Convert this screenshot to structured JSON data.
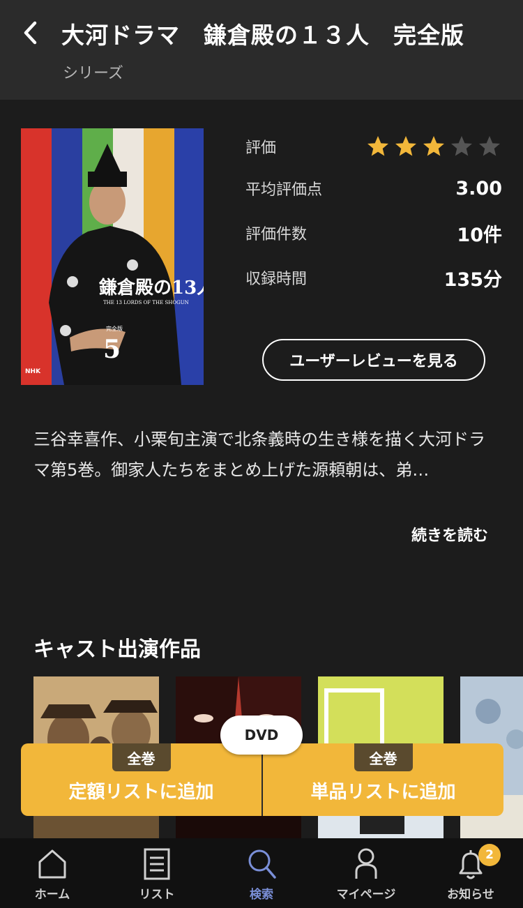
{
  "header": {
    "title": "大河ドラマ　鎌倉殿の１３人　完全版",
    "subtitle": "シリーズ"
  },
  "cover": {
    "title": "鎌倉殿の13人",
    "subtitle": "THE 13 LORDS OF THE SHOGUN",
    "volume_label": "完全版",
    "volume": "5",
    "publisher": "NHK"
  },
  "info": {
    "rating_label": "評価",
    "rating_stars": 3,
    "rating_max": 5,
    "avg_label": "平均評価点",
    "avg_value": "3.00",
    "count_label": "評価件数",
    "count_value": "10件",
    "duration_label": "収録時間",
    "duration_value": "135分"
  },
  "review_button": "ユーザーレビューを見る",
  "description": "三谷幸喜作、小栗旬主演で北条義時の生き様を描く大河ドラマ第5巻。御家人たちをまとめ上げた源頼朝は、弟…",
  "read_more": "続きを読む",
  "cast_section": {
    "title": "キャスト出演作品"
  },
  "add_bar": {
    "format": "DVD",
    "left_badge": "全巻",
    "left_label": "定額リストに追加",
    "right_badge": "全巻",
    "right_label": "単品リストに追加"
  },
  "tabs": [
    {
      "label": "ホーム",
      "icon": "home-icon"
    },
    {
      "label": "リスト",
      "icon": "list-icon"
    },
    {
      "label": "検索",
      "icon": "search-icon"
    },
    {
      "label": "マイページ",
      "icon": "person-icon"
    },
    {
      "label": "お知らせ",
      "icon": "bell-icon",
      "badge": "2"
    }
  ],
  "colors": {
    "accent": "#f2b73a",
    "active_tab": "#7a8fd8",
    "background": "#1c1c1c"
  }
}
